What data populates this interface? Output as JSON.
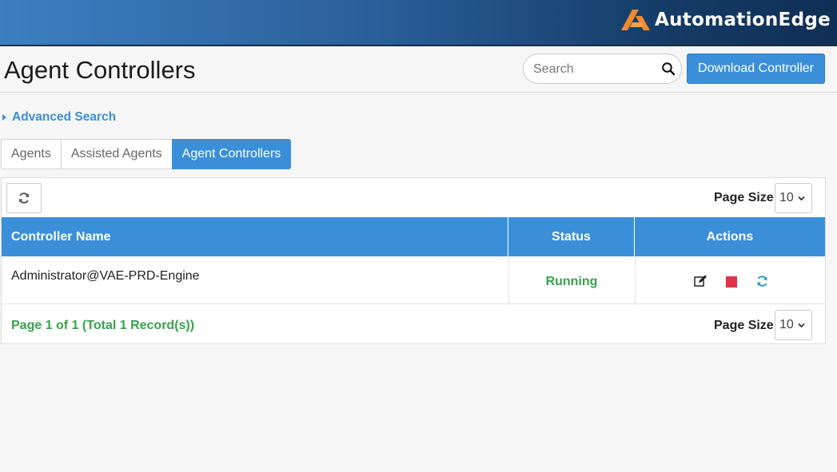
{
  "brand": {
    "name": "AutomationEdge",
    "logo_color": "#f08a2a"
  },
  "page": {
    "title": "Agent Controllers"
  },
  "search": {
    "placeholder": "Search"
  },
  "toolbar": {
    "download_label": "Download Controller"
  },
  "advanced_search": {
    "label": "Advanced Search"
  },
  "tabs": [
    {
      "label": "Agents",
      "active": false
    },
    {
      "label": "Assisted Agents",
      "active": false
    },
    {
      "label": "Agent Controllers",
      "active": true
    }
  ],
  "table": {
    "page_size_label": "Page Size",
    "page_size_value": "10",
    "columns": {
      "name": "Controller Name",
      "status": "Status",
      "actions": "Actions"
    },
    "rows": [
      {
        "name": "Administrator@VAE-PRD-Engine",
        "status": "Running",
        "status_color": "#37a34a"
      }
    ],
    "footer": {
      "page_info": "Page 1 of 1 (Total 1 Record(s))"
    }
  },
  "colors": {
    "accent": "#3a8fd8",
    "success": "#37a34a",
    "danger": "#e0344a"
  }
}
